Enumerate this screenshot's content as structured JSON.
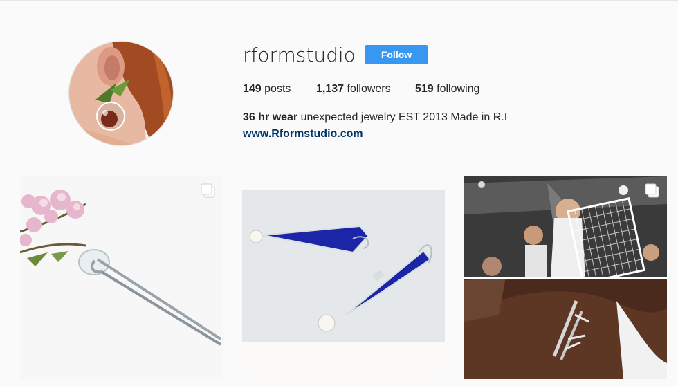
{
  "profile": {
    "username": "rformstudio",
    "follow_label": "Follow",
    "stats": [
      {
        "count": "149",
        "label": "posts"
      },
      {
        "count": "1,137",
        "label": "followers"
      },
      {
        "count": "519",
        "label": "following"
      }
    ],
    "bio_bold": "36 hr wear",
    "bio_text": "unexpected jewelry EST 2013 Made in R.I",
    "website": "www.Rformstudio.com"
  },
  "posts": [
    {
      "subject": "cherry blossom hair pin",
      "multi": true
    },
    {
      "subject": "blue glass drop earrings",
      "multi": false
    },
    {
      "subject": "party crowd and hair clip",
      "multi": true
    }
  ],
  "icons": {
    "multi_post": "carousel-icon"
  },
  "colors": {
    "background": "#fafafa",
    "follow_button": "#3897f0",
    "link": "#003569",
    "text": "#262626"
  }
}
